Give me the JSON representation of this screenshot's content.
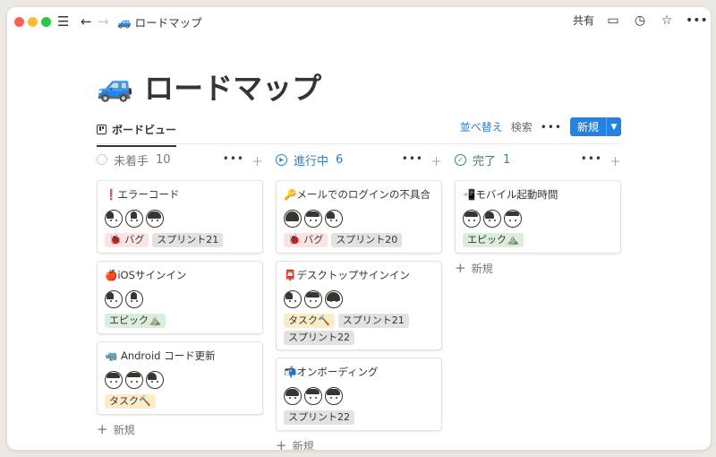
{
  "breadcrumb": {
    "emoji": "🚙",
    "title": "ロードマップ"
  },
  "topbar": {
    "share_label": "共有"
  },
  "page": {
    "emoji": "🚙",
    "title": "ロードマップ"
  },
  "view": {
    "tab_label": "ボードビュー",
    "sort_label": "並べ替え",
    "search_label": "検索",
    "more_label": "•••",
    "new_label": "新規"
  },
  "columns": [
    {
      "name": "未着手",
      "count": "10",
      "status_color": "#9b9a97",
      "cards": [
        {
          "title": "❗エラーコード",
          "avatar_count": 3,
          "tags": [
            "🐞 バグ",
            "スプリント21"
          ]
        },
        {
          "title": "🍎iOSサインイン",
          "avatar_count": 2,
          "tags": [
            "エピック⛰️"
          ]
        },
        {
          "title": "🦏 Android コード更新",
          "avatar_count": 3,
          "tags": [
            "タスク🔨"
          ]
        }
      ],
      "add_label": "新規"
    },
    {
      "name": "進行中",
      "count": "6",
      "status_color": "#2f7ec1",
      "cards": [
        {
          "title": "🔑メールでのログインの不具合",
          "avatar_count": 3,
          "tags": [
            "🐞 バグ",
            "スプリント20"
          ]
        },
        {
          "title": "📮デスクトップサインイン",
          "avatar_count": 3,
          "tags": [
            "タスク🔨",
            "スプリント21",
            "スプリント22"
          ]
        },
        {
          "title": "📬オンボーディング",
          "avatar_count": 3,
          "tags": [
            "スプリント22"
          ]
        }
      ],
      "add_label": "新規"
    },
    {
      "name": "完了",
      "count": "1",
      "status_color": "#448361",
      "cards": [
        {
          "title": "📲モバイル起動時間",
          "avatar_count": 3,
          "tags": [
            "エピック⛰️"
          ]
        }
      ],
      "add_label": "新規"
    }
  ]
}
